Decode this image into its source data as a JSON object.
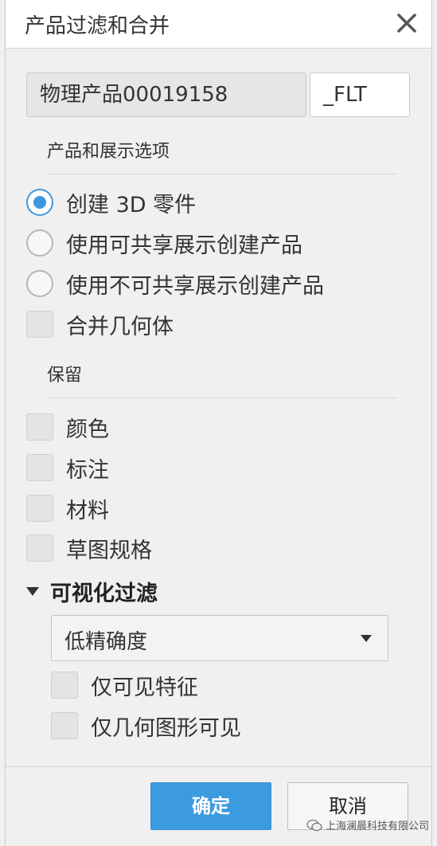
{
  "dialog": {
    "title": "产品过滤和合并",
    "close_icon": "close-icon"
  },
  "name": {
    "value": "物理产品00019158",
    "suffix": "_FLT"
  },
  "product_options": {
    "header": "产品和展示选项",
    "radios": [
      {
        "label": "创建 3D 零件",
        "selected": true
      },
      {
        "label": "使用可共享展示创建产品",
        "selected": false
      },
      {
        "label": "使用不可共享展示创建产品",
        "selected": false
      }
    ],
    "merge_geometry": {
      "label": "合并几何体",
      "checked": false
    }
  },
  "retain": {
    "header": "保留",
    "items": [
      {
        "label": "颜色",
        "checked": false
      },
      {
        "label": "标注",
        "checked": false
      },
      {
        "label": "材料",
        "checked": false
      },
      {
        "label": "草图规格",
        "checked": false
      }
    ]
  },
  "visual_filter": {
    "header": "可视化过滤",
    "dropdown_value": "低精确度",
    "options": [
      {
        "label": "仅可见特征",
        "checked": false
      },
      {
        "label": "仅几何图形可见",
        "checked": false
      }
    ]
  },
  "footer": {
    "ok_label": "确定",
    "cancel_label": "取消"
  },
  "watermark": {
    "text": "上海澜晨科技有限公司"
  },
  "colors": {
    "accent": "#3c9be0",
    "background": "#f0f0f0"
  }
}
